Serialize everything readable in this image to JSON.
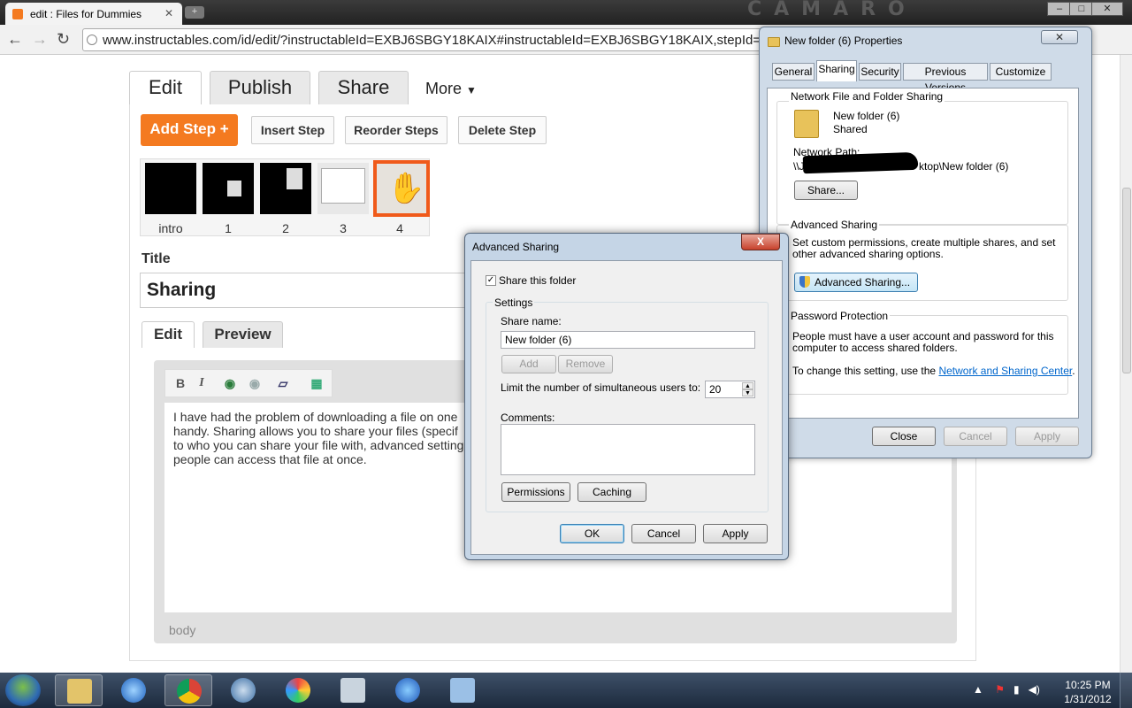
{
  "browser": {
    "tab_title": "edit : Files for Dummies",
    "tab_close": "✕",
    "new_tab": "+",
    "brand_text": "CAMARO",
    "url": "www.instructables.com/id/edit/?instructableId=EXBJ6SBGY18KAIX#instructableId=EXBJ6SBGY18KAIX,stepId=SJM"
  },
  "page": {
    "tabs": [
      "Edit",
      "Publish",
      "Share"
    ],
    "more": "More",
    "add_step": "Add Step",
    "insert_step": "Insert Step",
    "reorder_steps": "Reorder Steps",
    "delete_step": "Delete Step",
    "thumbs": [
      "intro",
      "1",
      "2",
      "3",
      "4"
    ],
    "title_label": "Title",
    "title_value": "Sharing",
    "editor_tabs": [
      "Edit",
      "Preview"
    ],
    "body_text": "I have had the problem of downloading a file on one handy. Sharing allows you to share your files (specif to who you can share your file with, advanced setting people can access that file at once.",
    "body_lines": [
      "I have had the problem of downloading a file on one",
      "handy. Sharing allows you to share your files (specif",
      "to who you can share your file with, advanced setting",
      "people can access that file at once."
    ],
    "body_label": "body"
  },
  "properties": {
    "title": "New folder (6) Properties",
    "tabs": [
      "General",
      "Sharing",
      "Security",
      "Previous Versions",
      "Customize"
    ],
    "active_tab": "Sharing",
    "nffs_title": "Network File and Folder Sharing",
    "folder_name": "New folder (6)",
    "folder_state": "Shared",
    "network_path_label": "Network Path:",
    "network_path_prefix": "\\\\J",
    "network_path_suffix": "ktop\\New folder (6)",
    "share_btn": "Share...",
    "adv_title": "Advanced Sharing",
    "adv_desc": "Set custom permissions, create multiple shares, and set other advanced sharing options.",
    "adv_btn": "Advanced Sharing...",
    "pw_title": "Password Protection",
    "pw_desc": "People must have a user account and password for this computer to access shared folders.",
    "pw_change": "To change this setting, use the",
    "pw_link": "Network and Sharing Center",
    "pw_period": ".",
    "close": "Close",
    "cancel": "Cancel",
    "apply": "Apply"
  },
  "advanced": {
    "title": "Advanced Sharing",
    "close_x": "X",
    "share_checkbox": "Share this folder",
    "share_checked": true,
    "settings": "Settings",
    "share_name_label": "Share name:",
    "share_name": "New folder (6)",
    "add": "Add",
    "remove": "Remove",
    "limit_label": "Limit the number of simultaneous users to:",
    "limit_value": "20",
    "comments_label": "Comments:",
    "permissions": "Permissions",
    "caching": "Caching",
    "ok": "OK",
    "cancel": "Cancel",
    "apply": "Apply"
  },
  "taskbar": {
    "time": "10:25 PM",
    "date": "1/31/2012",
    "icons": [
      "explorer-icon",
      "ie-icon",
      "chrome-icon",
      "mail-icon",
      "paint-icon",
      "calculator-icon",
      "itunes-icon",
      "keyboard-icon"
    ]
  }
}
